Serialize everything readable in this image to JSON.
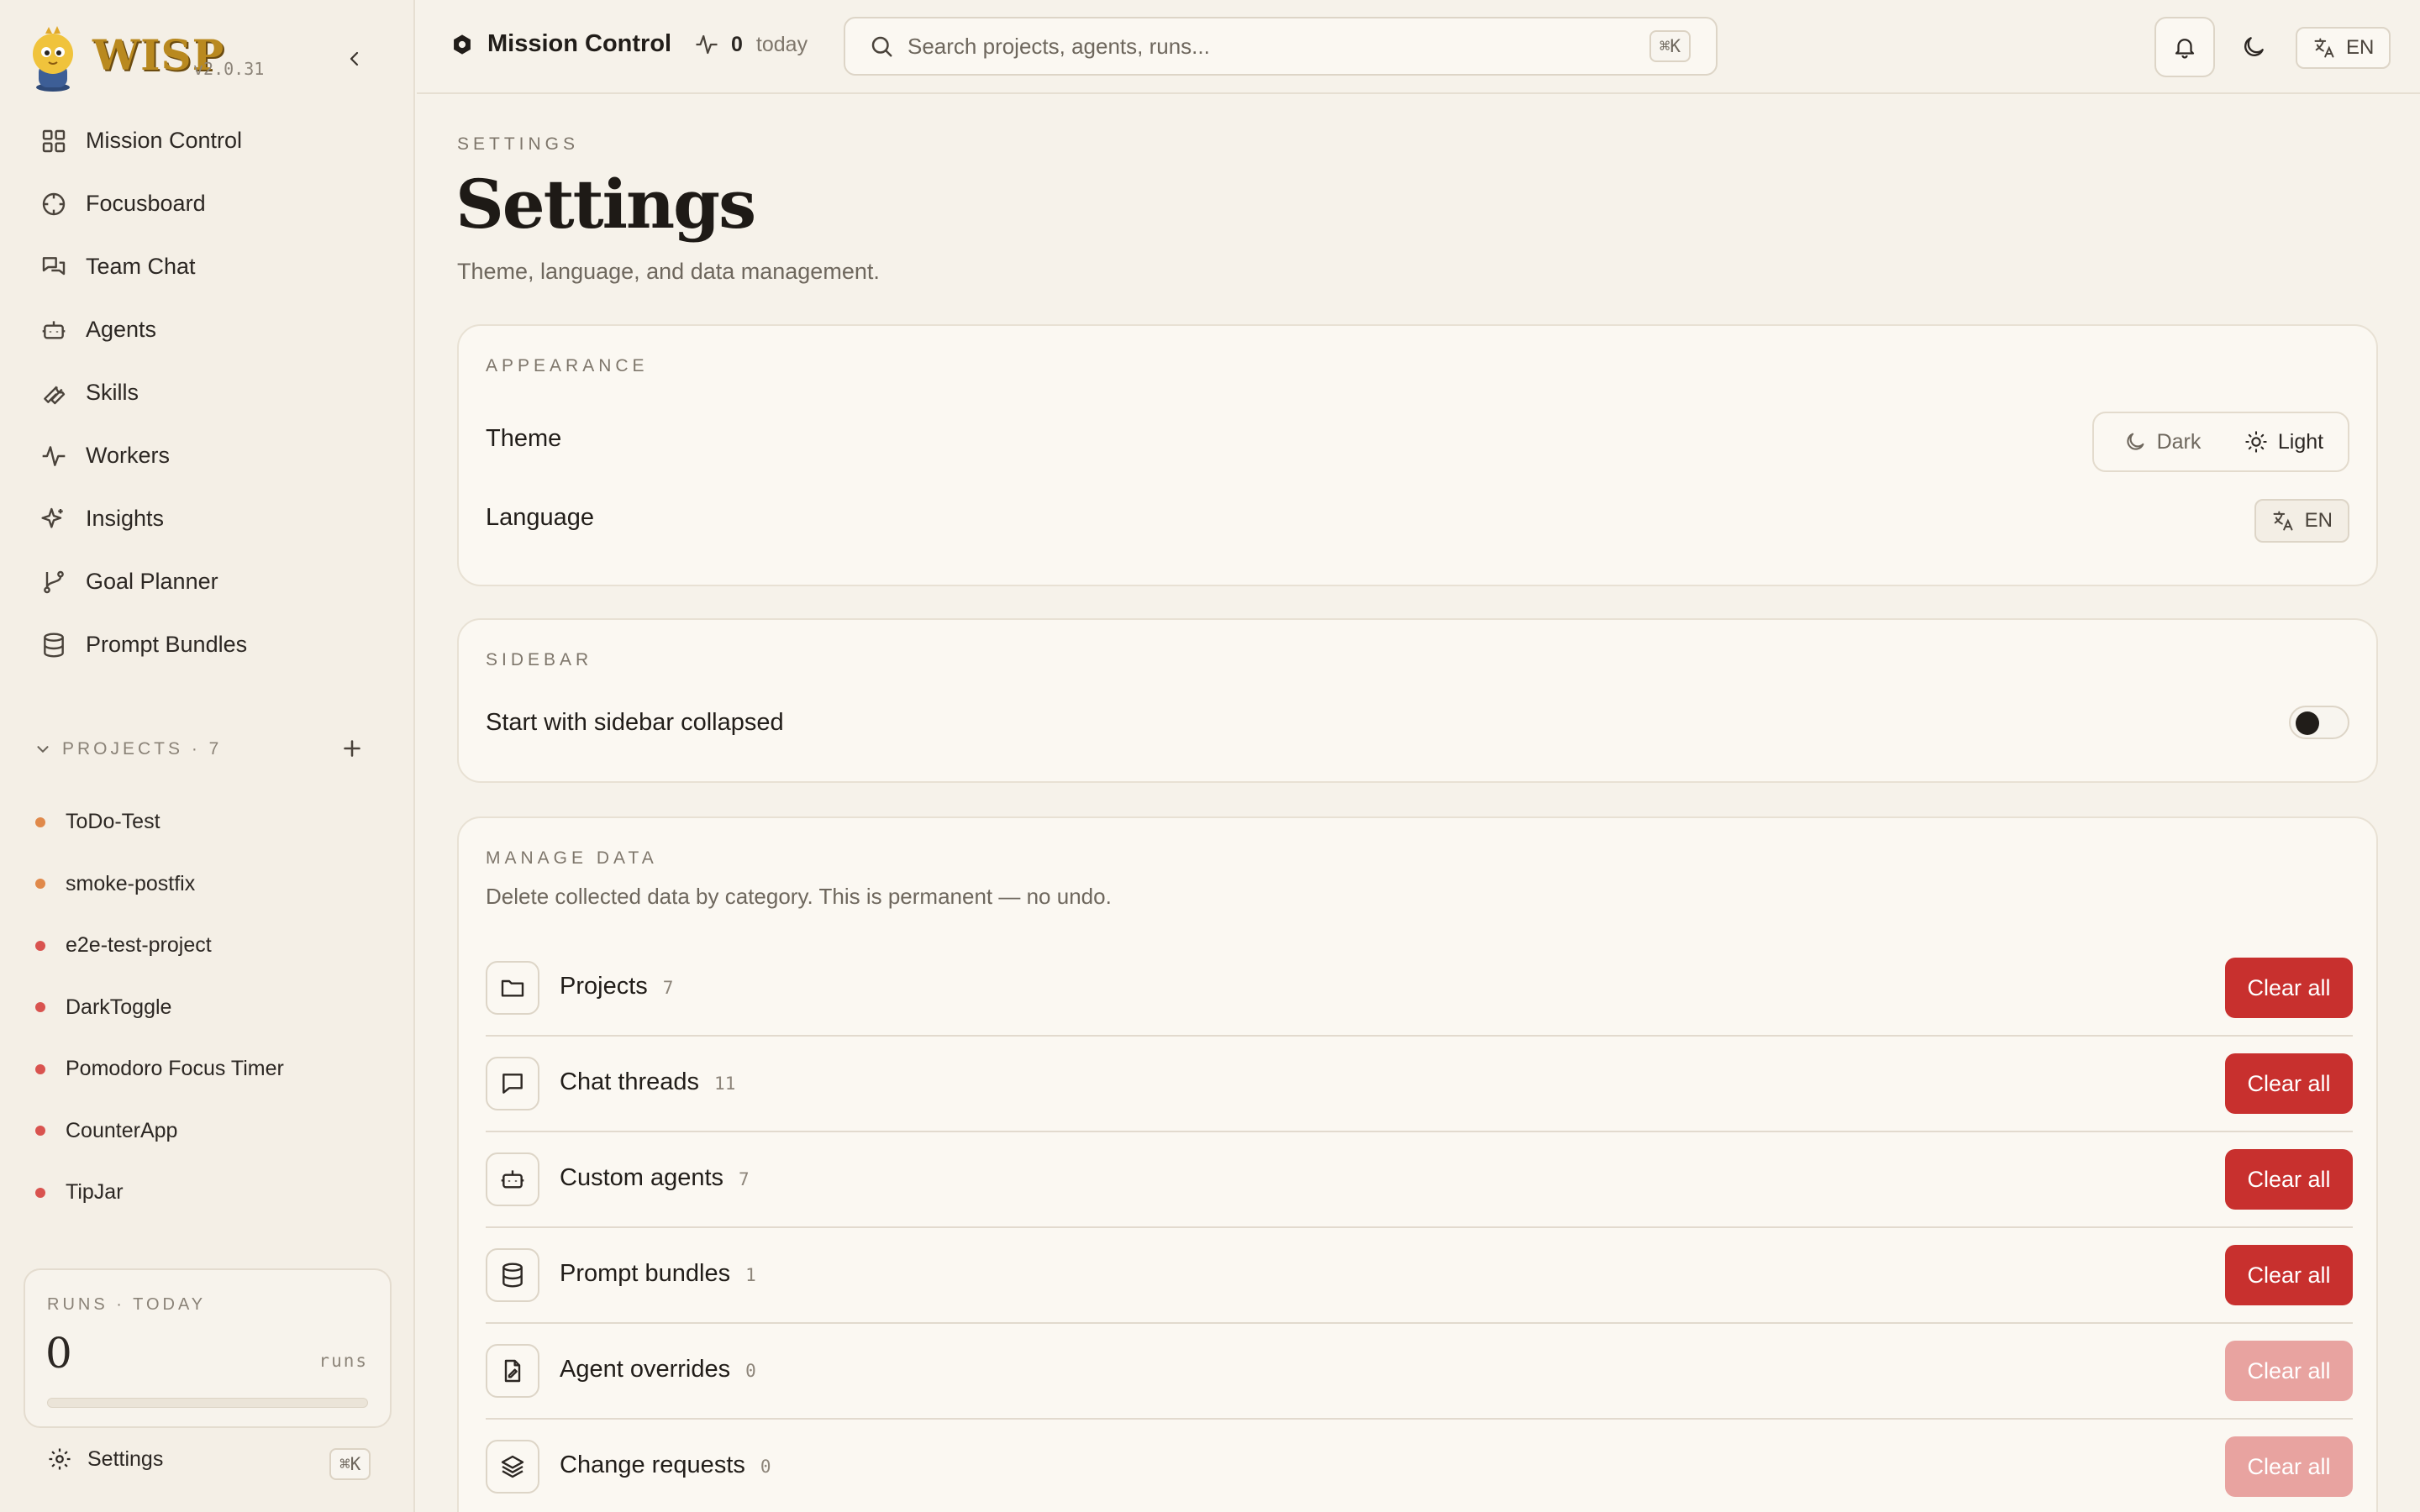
{
  "app": {
    "name": "WISP",
    "version": "v2.0.31"
  },
  "colors": {
    "accent_red": "#c8302e",
    "accent_red_disabled": "#e8a3a0",
    "project_dot_orange": "#e0894a",
    "project_dot_red": "#d9534f",
    "background": "#f6f2ea"
  },
  "sidebar": {
    "nav": [
      {
        "label": "Mission Control",
        "icon": "grid-icon"
      },
      {
        "label": "Focusboard",
        "icon": "crosshair-icon"
      },
      {
        "label": "Team Chat",
        "icon": "chat-bubbles-icon"
      },
      {
        "label": "Agents",
        "icon": "robot-icon"
      },
      {
        "label": "Skills",
        "icon": "wrench-icon"
      },
      {
        "label": "Workers",
        "icon": "activity-icon"
      },
      {
        "label": "Insights",
        "icon": "sparkles-icon"
      },
      {
        "label": "Goal Planner",
        "icon": "branch-icon"
      },
      {
        "label": "Prompt Bundles",
        "icon": "database-icon"
      }
    ],
    "projects_label": "PROJECTS · 7",
    "projects": [
      {
        "name": "ToDo-Test",
        "dot": "orange"
      },
      {
        "name": "smoke-postfix",
        "dot": "orange"
      },
      {
        "name": "e2e-test-project",
        "dot": "red"
      },
      {
        "name": "DarkToggle",
        "dot": "red"
      },
      {
        "name": "Pomodoro Focus Timer",
        "dot": "red"
      },
      {
        "name": "CounterApp",
        "dot": "red"
      },
      {
        "name": "TipJar",
        "dot": "red"
      }
    ],
    "runs_card": {
      "label": "RUNS · TODAY",
      "value": "0",
      "unit": "runs",
      "progress": 0
    },
    "settings_label": "Settings",
    "settings_shortcut": "⌘K"
  },
  "topbar": {
    "title": "Mission Control",
    "runs_count": "0",
    "runs_period": "today",
    "search_placeholder": "Search projects, agents, runs...",
    "search_shortcut": "⌘K",
    "language": "EN"
  },
  "page": {
    "eyebrow": "SETTINGS",
    "title": "Settings",
    "subtitle": "Theme, language, and data management."
  },
  "appearance": {
    "label": "APPEARANCE",
    "theme_label": "Theme",
    "theme_dark": "Dark",
    "theme_light": "Light",
    "theme_selected": "Light",
    "language_label": "Language",
    "language_value": "EN"
  },
  "sidebar_settings": {
    "label": "SIDEBAR",
    "collapse_label": "Start with sidebar collapsed",
    "collapse_enabled": false
  },
  "manage_data": {
    "label": "MANAGE DATA",
    "description": "Delete collected data by category. This is permanent — no undo.",
    "button_label": "Clear all",
    "rows": [
      {
        "name": "Projects",
        "count": "7",
        "icon": "folder-icon",
        "enabled": true
      },
      {
        "name": "Chat threads",
        "count": "11",
        "icon": "message-square-icon",
        "enabled": true
      },
      {
        "name": "Custom agents",
        "count": "7",
        "icon": "robot-icon",
        "enabled": true
      },
      {
        "name": "Prompt bundles",
        "count": "1",
        "icon": "database-icon",
        "enabled": true
      },
      {
        "name": "Agent overrides",
        "count": "0",
        "icon": "file-edit-icon",
        "enabled": false
      },
      {
        "name": "Change requests",
        "count": "0",
        "icon": "layers-icon",
        "enabled": false
      }
    ]
  }
}
